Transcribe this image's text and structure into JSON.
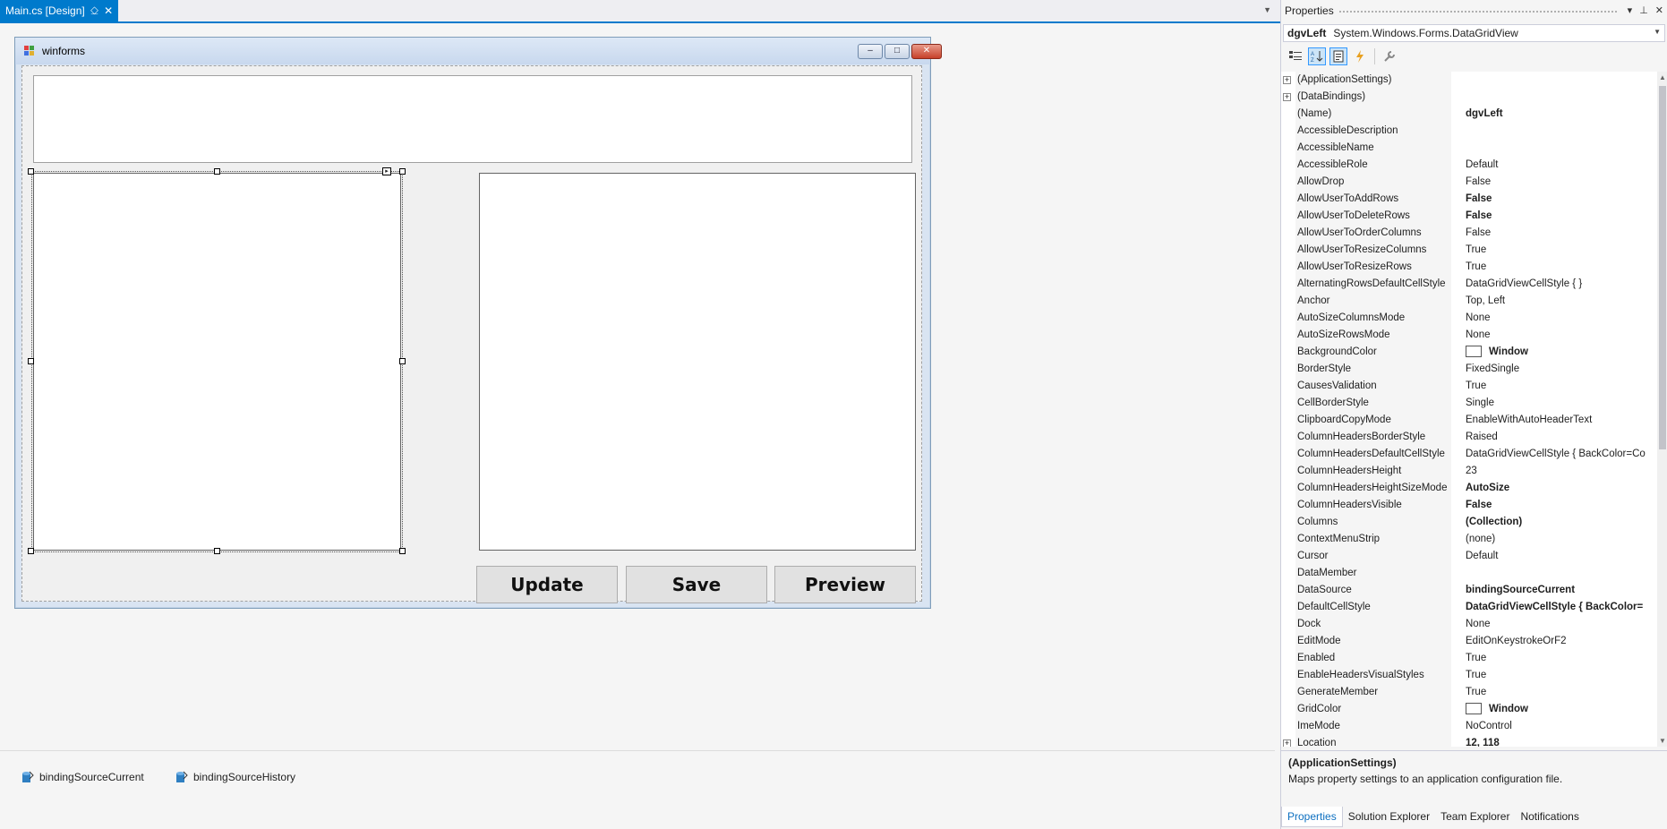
{
  "doc_tab": {
    "label": "Main.cs [Design]",
    "pin": "⎐",
    "close": "✕"
  },
  "form": {
    "title": "winforms",
    "min": "–",
    "max": "□",
    "close": "✕",
    "buttons": {
      "update": "Update",
      "save": "Save",
      "preview": "Preview"
    }
  },
  "tray": {
    "items": [
      "bindingSourceCurrent",
      "bindingSourceHistory"
    ]
  },
  "properties": {
    "title": "Properties",
    "object_name": "dgvLeft",
    "object_type": "System.Windows.Forms.DataGridView",
    "rows": [
      {
        "name": "(ApplicationSettings)",
        "value": "",
        "expander": "+",
        "bold": false
      },
      {
        "name": "(DataBindings)",
        "value": "",
        "expander": "+",
        "bold": false
      },
      {
        "name": "(Name)",
        "value": "dgvLeft",
        "bold": true
      },
      {
        "name": "AccessibleDescription",
        "value": ""
      },
      {
        "name": "AccessibleName",
        "value": ""
      },
      {
        "name": "AccessibleRole",
        "value": "Default"
      },
      {
        "name": "AllowDrop",
        "value": "False"
      },
      {
        "name": "AllowUserToAddRows",
        "value": "False",
        "bold": true
      },
      {
        "name": "AllowUserToDeleteRows",
        "value": "False",
        "bold": true
      },
      {
        "name": "AllowUserToOrderColumns",
        "value": "False"
      },
      {
        "name": "AllowUserToResizeColumns",
        "value": "True"
      },
      {
        "name": "AllowUserToResizeRows",
        "value": "True"
      },
      {
        "name": "AlternatingRowsDefaultCellStyle",
        "value": "DataGridViewCellStyle { }"
      },
      {
        "name": "Anchor",
        "value": "Top, Left"
      },
      {
        "name": "AutoSizeColumnsMode",
        "value": "None"
      },
      {
        "name": "AutoSizeRowsMode",
        "value": "None"
      },
      {
        "name": "BackgroundColor",
        "value": "Window",
        "bold": true,
        "swatch": "#ffffff"
      },
      {
        "name": "BorderStyle",
        "value": "FixedSingle"
      },
      {
        "name": "CausesValidation",
        "value": "True"
      },
      {
        "name": "CellBorderStyle",
        "value": "Single"
      },
      {
        "name": "ClipboardCopyMode",
        "value": "EnableWithAutoHeaderText"
      },
      {
        "name": "ColumnHeadersBorderStyle",
        "value": "Raised"
      },
      {
        "name": "ColumnHeadersDefaultCellStyle",
        "value": "DataGridViewCellStyle { BackColor=Co"
      },
      {
        "name": "ColumnHeadersHeight",
        "value": "23"
      },
      {
        "name": "ColumnHeadersHeightSizeMode",
        "value": "AutoSize",
        "bold": true
      },
      {
        "name": "ColumnHeadersVisible",
        "value": "False",
        "bold": true
      },
      {
        "name": "Columns",
        "value": "(Collection)",
        "bold": true
      },
      {
        "name": "ContextMenuStrip",
        "value": "(none)"
      },
      {
        "name": "Cursor",
        "value": "Default"
      },
      {
        "name": "DataMember",
        "value": ""
      },
      {
        "name": "DataSource",
        "value": "bindingSourceCurrent",
        "bold": true
      },
      {
        "name": "DefaultCellStyle",
        "value": "DataGridViewCellStyle { BackColor=",
        "bold": true
      },
      {
        "name": "Dock",
        "value": "None"
      },
      {
        "name": "EditMode",
        "value": "EditOnKeystrokeOrF2"
      },
      {
        "name": "Enabled",
        "value": "True"
      },
      {
        "name": "EnableHeadersVisualStyles",
        "value": "True"
      },
      {
        "name": "GenerateMember",
        "value": "True"
      },
      {
        "name": "GridColor",
        "value": "Window",
        "bold": true,
        "swatch": "#ffffff"
      },
      {
        "name": "ImeMode",
        "value": "NoControl"
      },
      {
        "name": "Location",
        "value": "12, 118",
        "bold": true,
        "expander": "+"
      }
    ],
    "description": {
      "title": "(ApplicationSettings)",
      "text": "Maps property settings to an application configuration file."
    },
    "bottom_tabs": [
      "Properties",
      "Solution Explorer",
      "Team Explorer",
      "Notifications"
    ]
  },
  "colors": {
    "accent": "#007acc",
    "selected_tab_text": "#0e70c0"
  }
}
